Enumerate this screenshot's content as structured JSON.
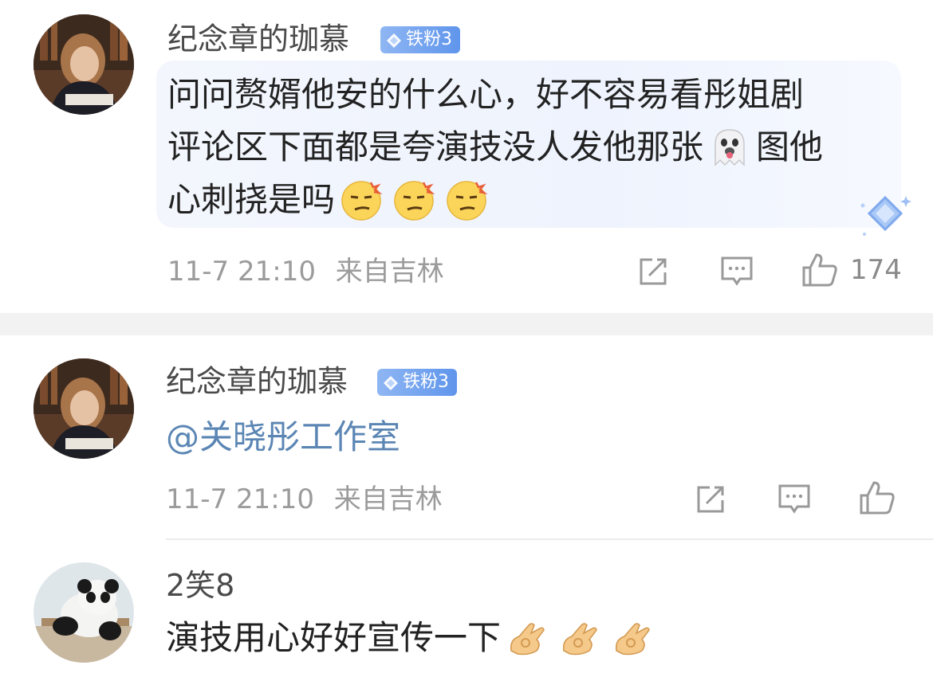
{
  "comments": [
    {
      "username": "纪念章的珈慕",
      "badge": "铁粉3",
      "text_rows": [
        "问问赘婿他安的什么心，好不容易看彤姐剧",
        "评论区下面都是夸演技没人发他那张",
        "图他",
        "心刺挠是吗"
      ],
      "emojis": [
        "ghost-tongue-emoji",
        "smirk-emoji",
        "smirk-emoji",
        "smirk-emoji"
      ],
      "time": "11-7 21:10",
      "location": "来自吉林",
      "like_count": "174"
    },
    {
      "username": "纪念章的珈慕",
      "badge": "铁粉3",
      "mention": "@关晓彤工作室",
      "time": "11-7 21:10",
      "location": "来自吉林"
    },
    {
      "username": "2笑8",
      "text": "演技用心好好宣传一下",
      "emojis": [
        "ok-hand-emoji",
        "ok-hand-emoji",
        "ok-hand-emoji"
      ]
    }
  ],
  "colors": {
    "badge": "#6a9cf0",
    "mention": "#5b86b4",
    "meta": "#9b9b9b",
    "bubble": "#f1f5fd"
  }
}
